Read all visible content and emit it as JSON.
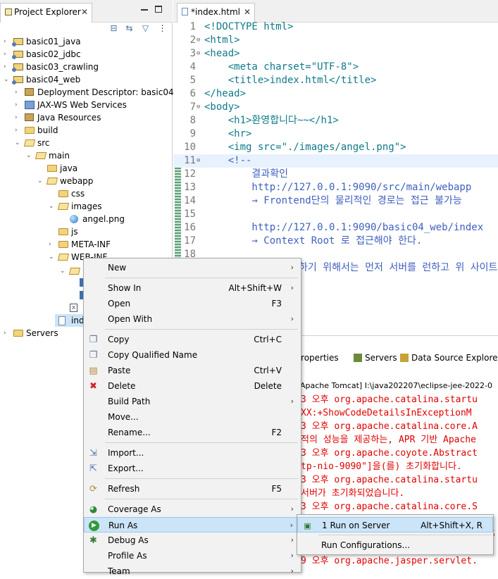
{
  "project_explorer": {
    "tab_label": "Project Explorer",
    "tree": [
      {
        "label": "basic01_java"
      },
      {
        "label": "basic02_jdbc"
      },
      {
        "label": "basic03_crawling"
      },
      {
        "label": "basic04_web"
      },
      {
        "label": "Deployment Descriptor: basic04_we"
      },
      {
        "label": "JAX-WS Web Services"
      },
      {
        "label": "Java Resources"
      },
      {
        "label": "build"
      },
      {
        "label": "src"
      },
      {
        "label": "main"
      },
      {
        "label": "java"
      },
      {
        "label": "webapp"
      },
      {
        "label": "css"
      },
      {
        "label": "images"
      },
      {
        "label": "angel.png"
      },
      {
        "label": "js"
      },
      {
        "label": "META-INF"
      },
      {
        "label": "WEB-INF"
      },
      {
        "label": "ind"
      },
      {
        "label": "Servers"
      }
    ]
  },
  "editor": {
    "tab_label": "*index.html",
    "lines": [
      {
        "n": "1",
        "code": "<!DOCTYPE html>"
      },
      {
        "n": "2",
        "code": "<html>"
      },
      {
        "n": "3",
        "code": "<head>"
      },
      {
        "n": "4",
        "code": "    <meta charset=\"UTF-8\">"
      },
      {
        "n": "5",
        "code": "    <title>index.html</title>"
      },
      {
        "n": "6",
        "code": "</head>"
      },
      {
        "n": "7",
        "code": "<body>"
      },
      {
        "n": "8",
        "code": "    <h1>환영합니다~~</h1>"
      },
      {
        "n": "9",
        "code": "    <hr>"
      },
      {
        "n": "10",
        "code": "    <img src=\"./images/angel.png\">"
      },
      {
        "n": "11",
        "code": "    <!--"
      },
      {
        "n": "12",
        "code": "        결과확인"
      },
      {
        "n": "13",
        "code": "        http://127.0.0.1:9090/src/main/webapp"
      },
      {
        "n": "14",
        "code": "        → Frontend단의 물리적인 경로는 접근 불가능"
      },
      {
        "n": "15",
        "code": ""
      },
      {
        "n": "16",
        "code": "        http://127.0.0.1:9090/basic04_web/index"
      },
      {
        "n": "17",
        "code": "        → Context Root 로 접근해야 한다."
      },
      {
        "n": "18",
        "code": ""
      },
      {
        "n": "",
        "code": "하기 위해서는 먼저 서버를 런하고 위 사이트에"
      }
    ]
  },
  "bottom_panel": {
    "tabs": [
      "Properties",
      "Servers",
      "Data Source Explorer"
    ],
    "console_title": "Apache Tomcat] I:\\java202207\\eclipse-jee-2022-0",
    "console_lines": [
      "3 오후 org.apache.catalina.startu",
      "XX:+ShowCodeDetailsInExceptionM",
      "3 오후 org.apache.catalina.core.A",
      "적의 성능을 제공하는, APR 기반 Apache",
      "3 오후 org.apache.coyote.Abstract",
      "tp-nio-9090\"]을(를) 초기화합니다.",
      "3 오후 org.apache.catalina.startu",
      "서버가 초기화되었습니다.",
      "3 오후 org.apache.catalina.core.S",
      "",
      "",
      "S",
      "9 오후 org.apache.jasper.servlet."
    ]
  },
  "context_menu": {
    "items": [
      {
        "label": "New",
        "shortcut": "",
        "submenu": true
      },
      {
        "label": "Show In",
        "shortcut": "Alt+Shift+W",
        "submenu": true
      },
      {
        "label": "Open",
        "shortcut": "F3",
        "submenu": false
      },
      {
        "label": "Open With",
        "shortcut": "",
        "submenu": true
      },
      {
        "label": "Copy",
        "shortcut": "Ctrl+C",
        "submenu": false
      },
      {
        "label": "Copy Qualified Name",
        "shortcut": "",
        "submenu": false
      },
      {
        "label": "Paste",
        "shortcut": "Ctrl+V",
        "submenu": false
      },
      {
        "label": "Delete",
        "shortcut": "Delete",
        "submenu": false
      },
      {
        "label": "Build Path",
        "shortcut": "",
        "submenu": true
      },
      {
        "label": "Move...",
        "shortcut": "",
        "submenu": false
      },
      {
        "label": "Rename...",
        "shortcut": "F2",
        "submenu": false
      },
      {
        "label": "Import...",
        "shortcut": "",
        "submenu": false
      },
      {
        "label": "Export...",
        "shortcut": "",
        "submenu": false
      },
      {
        "label": "Refresh",
        "shortcut": "F5",
        "submenu": false
      },
      {
        "label": "Coverage As",
        "shortcut": "",
        "submenu": true
      },
      {
        "label": "Run As",
        "shortcut": "",
        "submenu": true
      },
      {
        "label": "Debug As",
        "shortcut": "",
        "submenu": true
      },
      {
        "label": "Profile As",
        "shortcut": "",
        "submenu": true
      },
      {
        "label": "Team",
        "shortcut": "",
        "submenu": true
      }
    ],
    "arrow": "›"
  },
  "submenu": {
    "items": [
      {
        "label": "1 Run on Server",
        "shortcut": "Alt+Shift+X, R"
      },
      {
        "label": "Run Configurations...",
        "shortcut": ""
      }
    ]
  },
  "glyphs": {
    "close": "✕",
    "collapsed": "›",
    "expanded": "⌄"
  }
}
